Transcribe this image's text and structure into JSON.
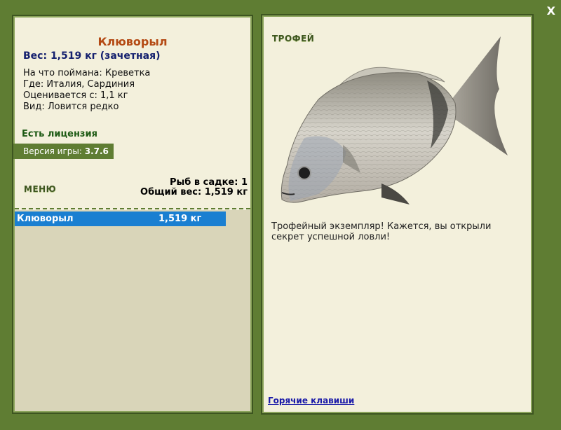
{
  "window": {
    "close_label": "X"
  },
  "left_panel": {
    "fish_name": "Клюворыл",
    "weight_line": "Вес: 1,519 кг (зачетная)",
    "bait_line": "На что поймана: Креветка",
    "where_line": "Где: Италия, Сардиния",
    "value_line": "Оценивается с: 1,1 кг",
    "kind_line": "Вид: Ловится редко",
    "license": "Есть лицензия",
    "version_label": "Версия игры: ",
    "version_value": "3.7.6",
    "menu": "МЕНЮ",
    "fish_count": "Рыб в садке: 1",
    "total_weight": "Общий вес: 1,519 кг",
    "catch_list": [
      {
        "name": "Клюворыл",
        "weight": "1,519 кг"
      }
    ]
  },
  "right_panel": {
    "trophy": "ТРОФЕЙ",
    "description": "Трофейный экземпляр! Кажется, вы открыли секрет успешной ловли!",
    "hotkeys_link": "Горячие клавиши"
  },
  "colors": {
    "background": "#5f7d33",
    "panel": "#f3f0dc",
    "selection": "#1a7fd1",
    "fish_name": "#b44a14"
  }
}
